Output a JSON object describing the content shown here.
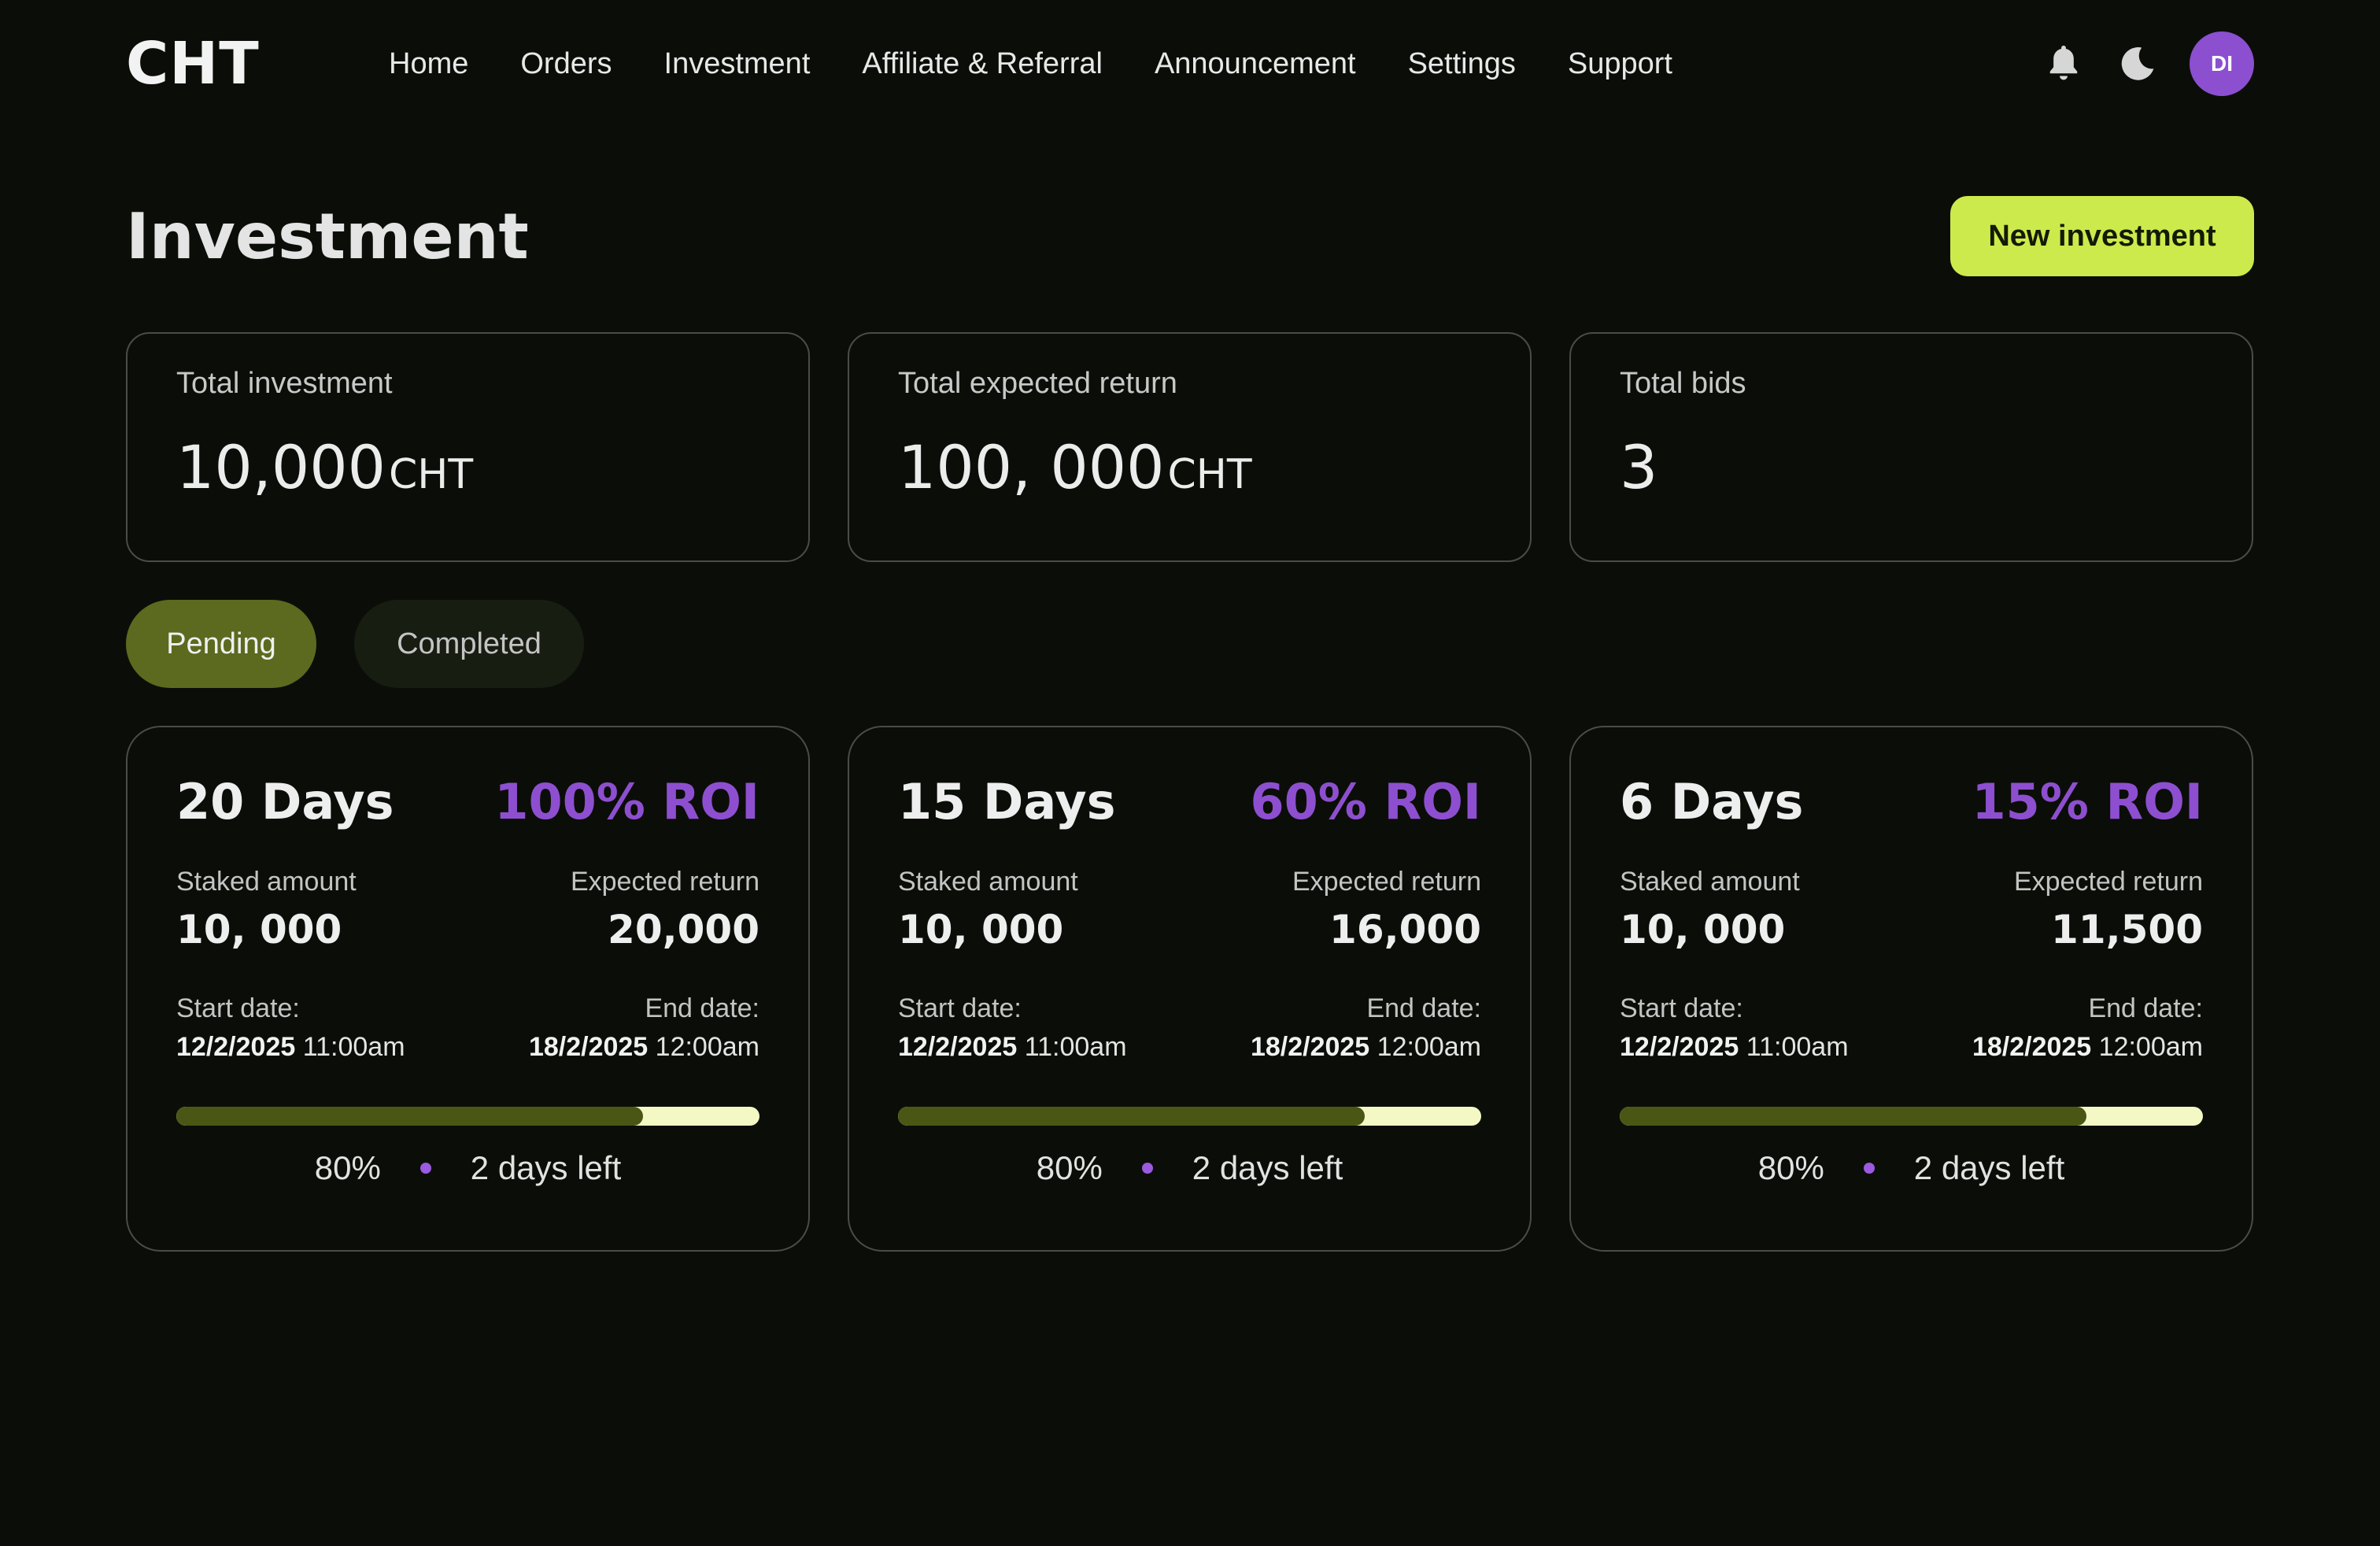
{
  "brand": {
    "logo": "CHT"
  },
  "nav": {
    "items": [
      {
        "label": "Home"
      },
      {
        "label": "Orders"
      },
      {
        "label": "Investment"
      },
      {
        "label": "Affiliate & Referral"
      },
      {
        "label": "Announcement"
      },
      {
        "label": "Settings"
      },
      {
        "label": "Support"
      }
    ],
    "icons": [
      "bell-icon",
      "moon-icon"
    ],
    "avatar_initials": "DI"
  },
  "page": {
    "title": "Investment",
    "new_button_label": "New investment"
  },
  "stats": [
    {
      "label": "Total investment",
      "value": "10,000",
      "unit": "CHT"
    },
    {
      "label": "Total expected return",
      "value": "100, 000",
      "unit": "CHT"
    },
    {
      "label": "Total bids",
      "value": "3",
      "unit": ""
    }
  ],
  "tabs": [
    {
      "label": "Pending",
      "active": true
    },
    {
      "label": "Completed",
      "active": false
    }
  ],
  "investments": [
    {
      "duration": "20 Days",
      "roi": "100% ROI",
      "staked_label": "Staked amount",
      "staked": "10, 000",
      "return_label": "Expected return",
      "expected_return": "20,000",
      "start_label": "Start date:",
      "start_date": "12/2/2025",
      "start_time": "11:00am",
      "end_label": "End date:",
      "end_date": "18/2/2025",
      "end_time": "12:00am",
      "progress": 0.8,
      "progress_label": "80%",
      "time_left": "2 days left"
    },
    {
      "duration": "15 Days",
      "roi": "60% ROI",
      "staked_label": "Staked amount",
      "staked": "10, 000",
      "return_label": "Expected return",
      "expected_return": "16,000",
      "start_label": "Start date:",
      "start_date": "12/2/2025",
      "start_time": "11:00am",
      "end_label": "End date:",
      "end_date": "18/2/2025",
      "end_time": "12:00am",
      "progress": 0.8,
      "progress_label": "80%",
      "time_left": "2 days left"
    },
    {
      "duration": "6 Days",
      "roi": "15% ROI",
      "staked_label": "Staked amount",
      "staked": "10, 000",
      "return_label": "Expected return",
      "expected_return": "11,500",
      "start_label": "Start date:",
      "start_date": "12/2/2025",
      "start_time": "11:00am",
      "end_label": "End date:",
      "end_date": "18/2/2025",
      "end_time": "12:00am",
      "progress": 0.8,
      "progress_label": "80%",
      "time_left": "2 days left"
    }
  ],
  "colors": {
    "background": "#0b0e08",
    "accent_lime": "#cdea4c",
    "accent_purple": "#8d4fcf",
    "tab_active": "#5b6a1f",
    "progress_fill": "#4a5614",
    "progress_track": "#f3f8c4"
  }
}
